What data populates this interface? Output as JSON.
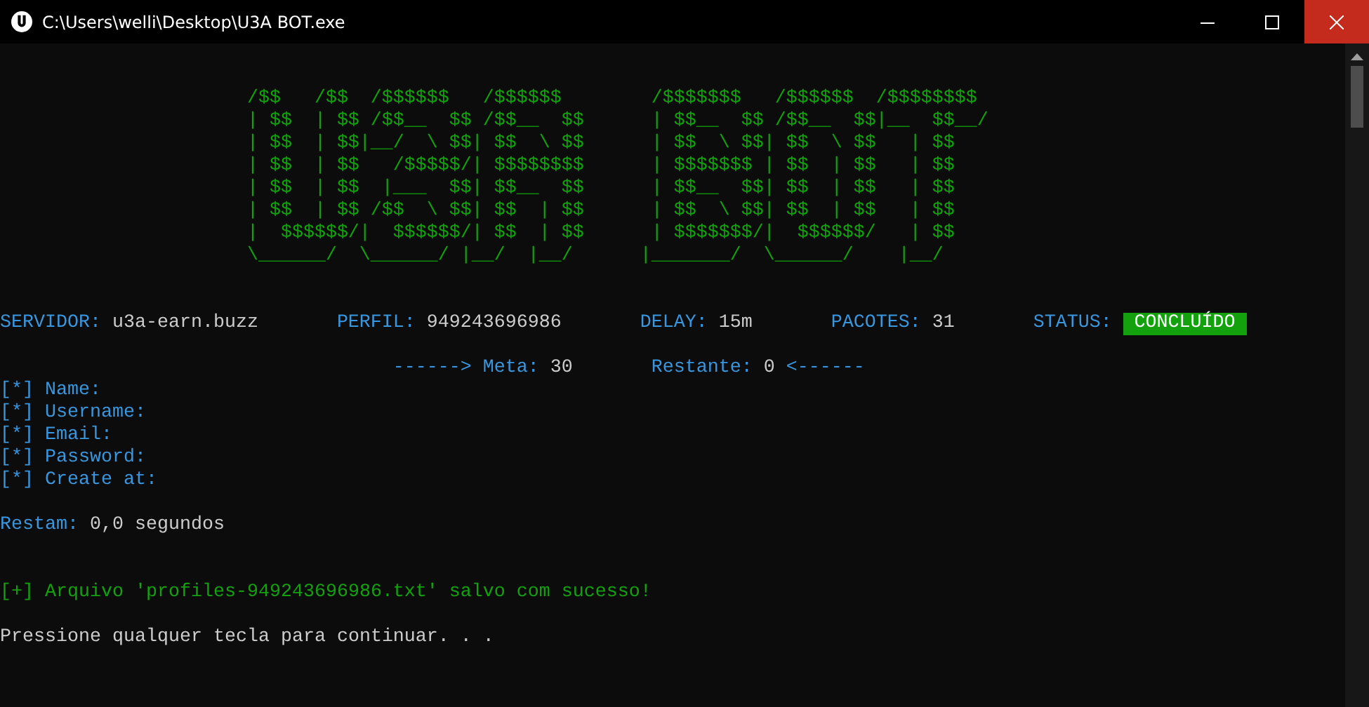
{
  "window": {
    "title": "C:\\Users\\welli\\Desktop\\U3A BOT.exe"
  },
  "banner": [
    "/$$   /$$  /$$$$$$   /$$$$$$        /$$$$$$$   /$$$$$$  /$$$$$$$$",
    "| $$  | $$ /$$__  $$ /$$__  $$      | $$__  $$ /$$__  $$|__  $$__/",
    "| $$  | $$|__/  \\ $$| $$  \\ $$      | $$  \\ $$| $$  \\ $$   | $$",
    "| $$  | $$   /$$$$$/| $$$$$$$$      | $$$$$$$ | $$  | $$   | $$",
    "| $$  | $$  |___  $$| $$__  $$      | $$__  $$| $$  | $$   | $$",
    "| $$  | $$ /$$  \\ $$| $$  | $$      | $$  \\ $$| $$  | $$   | $$",
    "|  $$$$$$/|  $$$$$$/| $$  | $$      | $$$$$$$/|  $$$$$$/   | $$",
    "\\______/  \\______/ |__/  |__/      |_______/  \\______/    |__/"
  ],
  "stats": [
    {
      "kind": "text",
      "label": "SERVIDOR:",
      "value": "u3a-earn.buzz"
    },
    {
      "kind": "text",
      "label": "PERFIL:",
      "value": "949243696986"
    },
    {
      "kind": "text",
      "label": "DELAY:",
      "value": "15m"
    },
    {
      "kind": "text",
      "label": "PACOTES:",
      "value": "31"
    },
    {
      "kind": "badge",
      "label": "STATUS:",
      "value": "CONCLUÍDO"
    }
  ],
  "progress": {
    "meta_label": "------> Meta:",
    "meta_value": "30",
    "rest_label": "Restante:",
    "rest_value": "0",
    "rest_arrow": "<------"
  },
  "fields": [
    {
      "marker": "[*]",
      "label": "Name:"
    },
    {
      "marker": "[*]",
      "label": "Username:"
    },
    {
      "marker": "[*]",
      "label": "Email:"
    },
    {
      "marker": "[*]",
      "label": "Password:"
    },
    {
      "marker": "[*]",
      "label": "Create at:"
    }
  ],
  "timer": {
    "label": "Restam:",
    "value": "0,0 segundos"
  },
  "saved_message": "[+] Arquivo 'profiles-949243696986.txt' salvo com sucesso!",
  "prompt": "Pressione qualquer tecla para continuar. . ."
}
